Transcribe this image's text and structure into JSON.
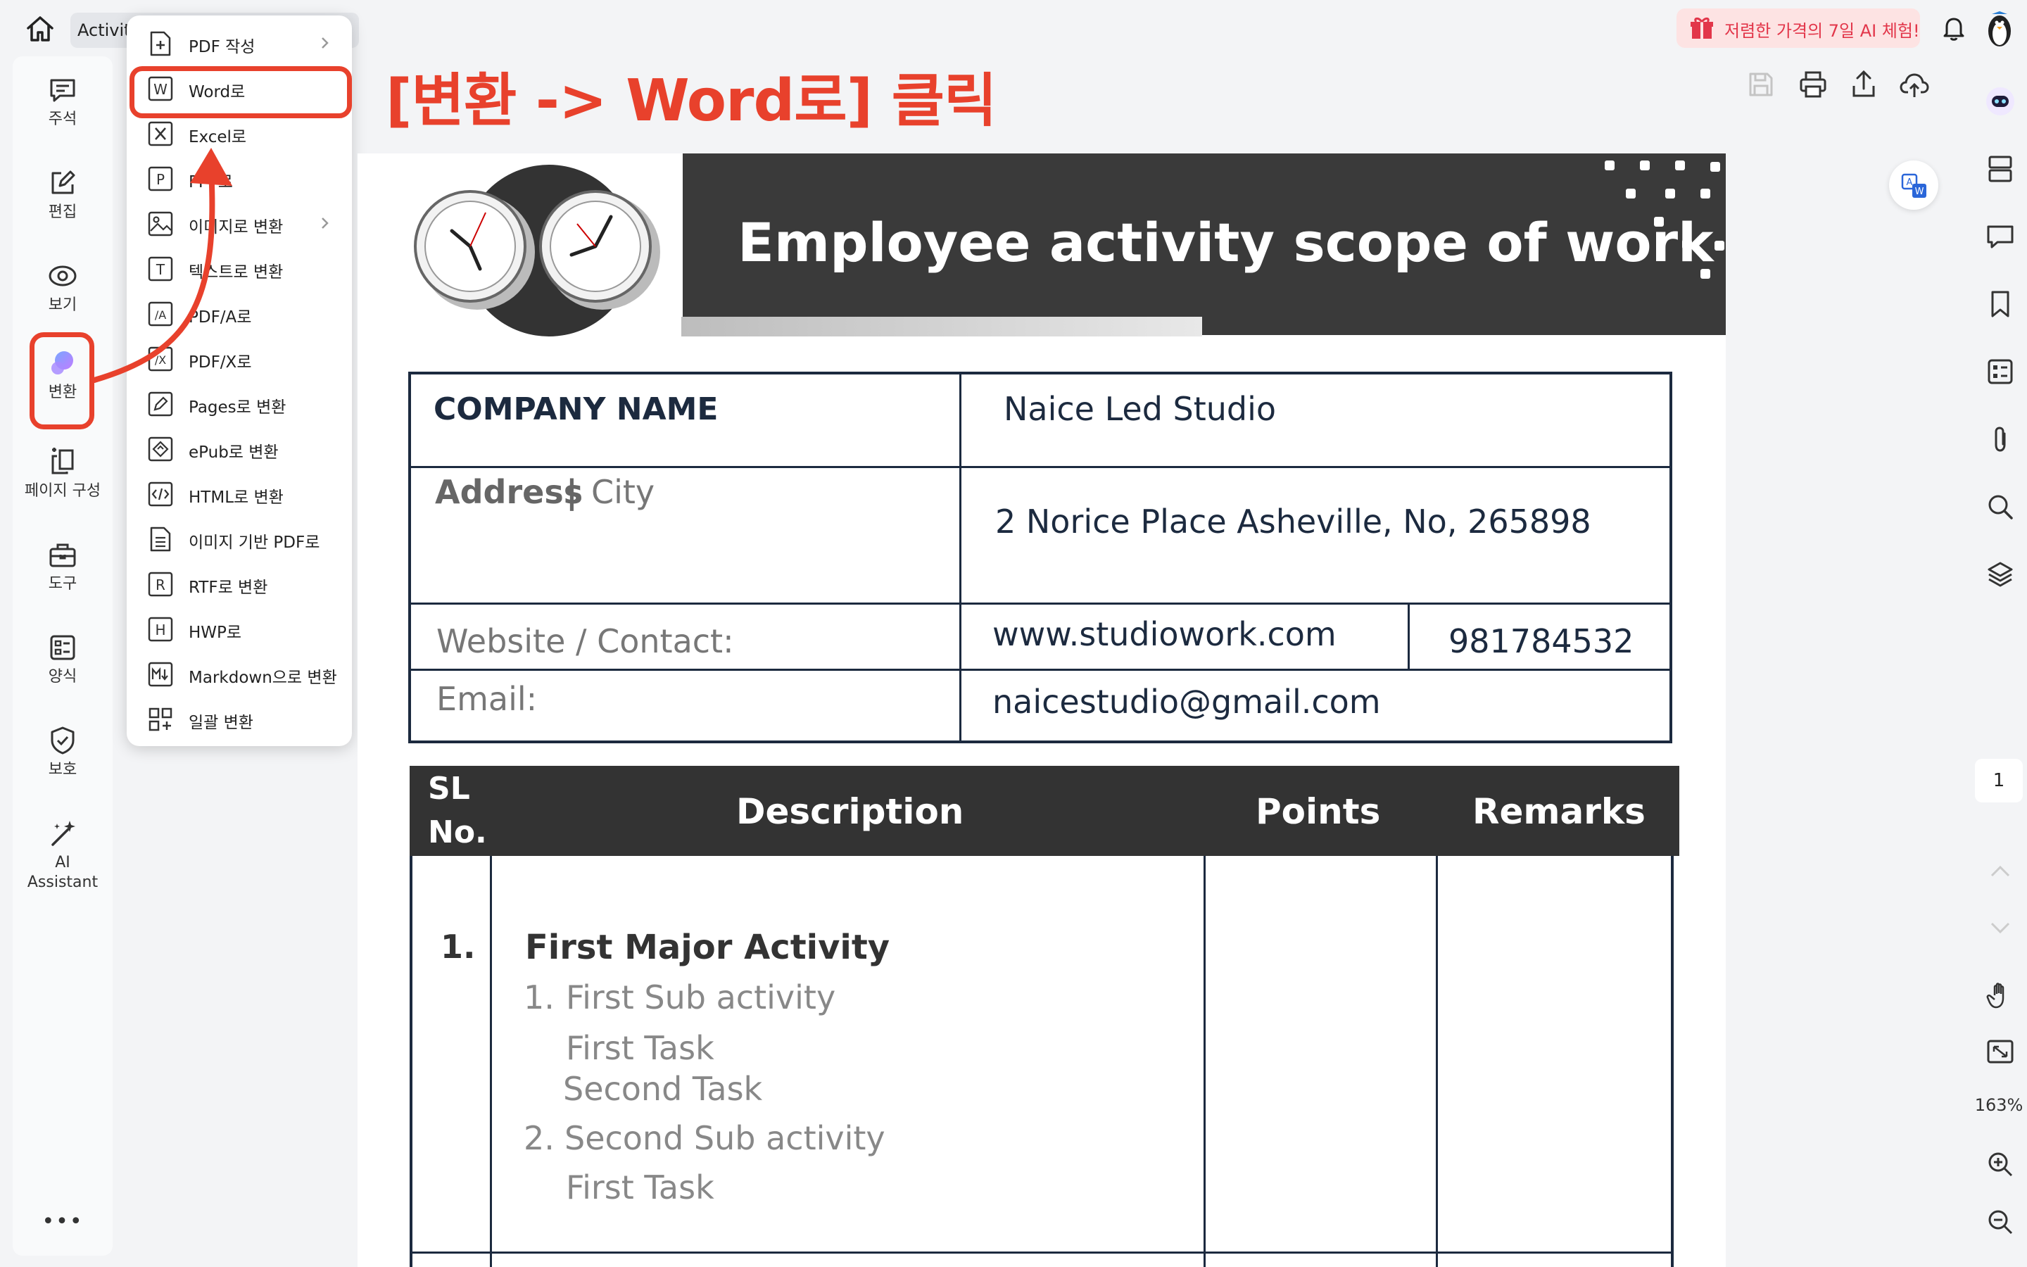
{
  "topbar": {
    "tab_label": "Activity",
    "tab_more": "-",
    "promo_text": "저렴한 가격의 7일 AI 체험!"
  },
  "left_sidebar": {
    "items": [
      {
        "label": "주석",
        "icon": "comment-icon"
      },
      {
        "label": "편집",
        "icon": "edit-icon"
      },
      {
        "label": "보기",
        "icon": "view-icon"
      },
      {
        "label": "변환",
        "icon": "convert-icon"
      },
      {
        "label": "페이지 구성",
        "icon": "page-organize-icon"
      },
      {
        "label": "도구",
        "icon": "toolbox-icon"
      },
      {
        "label": "양식",
        "icon": "form-icon"
      },
      {
        "label": "보호",
        "icon": "shield-icon"
      },
      {
        "label": "AI\nAssistant",
        "icon": "ai-wand-icon"
      }
    ],
    "more": "•••"
  },
  "convert_menu": {
    "items": [
      {
        "label": "PDF 작성",
        "icon": "pdf-create-icon",
        "submenu": true
      },
      {
        "label": "Word로",
        "icon": "word-icon",
        "submenu": false
      },
      {
        "label": "Excel로",
        "icon": "excel-icon",
        "submenu": false
      },
      {
        "label": "PPT로",
        "icon": "ppt-icon",
        "submenu": false
      },
      {
        "label": "이미지로 변환",
        "icon": "image-icon",
        "submenu": true
      },
      {
        "label": "텍스트로 변환",
        "icon": "text-icon",
        "submenu": false
      },
      {
        "label": "PDF/A로",
        "icon": "pdfa-icon",
        "submenu": false
      },
      {
        "label": "PDF/X로",
        "icon": "pdfx-icon",
        "submenu": false
      },
      {
        "label": "Pages로 변환",
        "icon": "pages-icon",
        "submenu": false
      },
      {
        "label": "ePub로 변환",
        "icon": "epub-icon",
        "submenu": false
      },
      {
        "label": "HTML로 변환",
        "icon": "html-icon",
        "submenu": false
      },
      {
        "label": "이미지 기반 PDF로",
        "icon": "image-pdf-icon",
        "submenu": false
      },
      {
        "label": "RTF로 변환",
        "icon": "rtf-icon",
        "submenu": false
      },
      {
        "label": "HWP로",
        "icon": "hwp-icon",
        "submenu": false
      },
      {
        "label": "Markdown으로 변환",
        "icon": "markdown-icon",
        "submenu": false
      },
      {
        "label": "일괄 변환",
        "icon": "batch-icon",
        "submenu": false
      }
    ]
  },
  "annotation": {
    "callout": "[변환 -> Word로] 클릭",
    "color": "#e8412c"
  },
  "right_sidebar": {
    "page_number": "1",
    "zoom": "163%"
  },
  "document": {
    "title": "Employee activity scope of work",
    "company_label": "COMPANY NAME",
    "company_value": "Naice Led Studio",
    "address_label": "Address",
    "address_sep": "|",
    "address_city": "City",
    "address_value": "2 Norice Place Asheville, No, 265898",
    "website_label": "Website / Contact:",
    "website_value": "www.studiowork.com",
    "phone_value": "981784532",
    "email_label": "Email:",
    "email_value": "naicestudio@gmail.com",
    "table": {
      "headers": [
        "SL\nNo.",
        "Description",
        "Points",
        "Remarks"
      ],
      "row_number": "1.",
      "activity": "First Major Activity",
      "sub1_num": "1.",
      "sub1": "First Sub activity",
      "task1": "First Task",
      "task2": "Second Task",
      "sub2_num": "2.",
      "sub2": "Second Sub activity",
      "task3": "First Task"
    }
  }
}
